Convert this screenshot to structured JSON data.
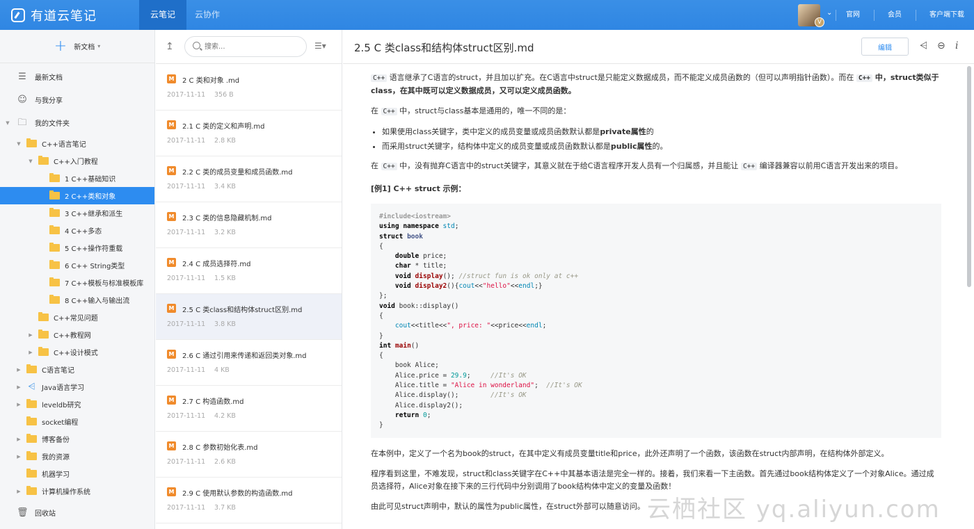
{
  "app": {
    "name": "有道云笔记"
  },
  "topnav": {
    "tabs": [
      "云笔记",
      "云协作"
    ],
    "links": [
      "官网",
      "会员",
      "客户端下载"
    ],
    "avatar_badge": "V"
  },
  "sidebar": {
    "new_doc": "新文档",
    "items": [
      {
        "label": "最新文档",
        "icon": "clock-stack-icon"
      },
      {
        "label": "与我分享",
        "icon": "user-share-icon"
      },
      {
        "label": "我的文件夹",
        "icon": "folder-outline-icon"
      },
      {
        "label": "C++语言笔记"
      },
      {
        "label": "C++入门教程"
      },
      {
        "label": "1 C++基础知识"
      },
      {
        "label": "2 C++类和对象"
      },
      {
        "label": "3 C++继承和派生"
      },
      {
        "label": "4 C++多态"
      },
      {
        "label": "5 C++操作符重载"
      },
      {
        "label": "6 C++ String类型"
      },
      {
        "label": "7 C++模板与标准模板库"
      },
      {
        "label": "8 C++输入与输出流"
      },
      {
        "label": "C++常见问题"
      },
      {
        "label": "C++教程网"
      },
      {
        "label": "C++设计模式"
      },
      {
        "label": "C语言笔记"
      },
      {
        "label": "Java语言学习"
      },
      {
        "label": "leveldb研究"
      },
      {
        "label": "socket编程"
      },
      {
        "label": "博客备份"
      },
      {
        "label": "我的资源"
      },
      {
        "label": "机器学习"
      },
      {
        "label": "计算机操作系统"
      }
    ],
    "trash": "回收站"
  },
  "list": {
    "search_placeholder": "搜索...",
    "items": [
      {
        "title": "2 C 类和对象 .md",
        "date": "2017-11-11",
        "size": "356 B"
      },
      {
        "title": "2.1 C 类的定义和声明.md",
        "date": "2017-11-11",
        "size": "2.8 KB"
      },
      {
        "title": "2.2 C 类的成员变量和成员函数.md",
        "date": "2017-11-11",
        "size": "3.4 KB"
      },
      {
        "title": "2.3 C 类的信息隐藏机制.md",
        "date": "2017-11-11",
        "size": "3.2 KB"
      },
      {
        "title": "2.4 C 成员选择符.md",
        "date": "2017-11-11",
        "size": "1.5 KB"
      },
      {
        "title": "2.5 C 类class和结构体struct区别.md",
        "date": "2017-11-11",
        "size": "3.8 KB"
      },
      {
        "title": "2.6 C 通过引用来传递和返回类对象.md",
        "date": "2017-11-11",
        "size": "4 KB"
      },
      {
        "title": "2.7 C 构造函数.md",
        "date": "2017-11-11",
        "size": "4.2 KB"
      },
      {
        "title": "2.8 C 参数初始化表.md",
        "date": "2017-11-11",
        "size": "2.6 KB"
      },
      {
        "title": "2.9 C 使用默认参数的构造函数.md",
        "date": "2017-11-11",
        "size": "3.7 KB"
      }
    ]
  },
  "doc": {
    "title": "2.5 C  类class和结构体struct区别.md",
    "edit_label": "编辑",
    "p1_kw": "C++",
    "p1_a": " 语言继承了C语言的struct，并且加以扩充。在C语言中struct是只能定义数据成员，而不能定义成员函数的（但可以声明指针函数）。而在 ",
    "p1_kw2": "C++",
    "p1_b": " 中，struct类似于class，在其中既可以定义数据成员，又可以定义成员函数。",
    "p2_a": "在 ",
    "p2_kw": "C++",
    "p2_b": " 中，struct与class基本是通用的，唯一不同的是：",
    "li1_a": "如果使用class关键字，类中定义的成员变量或成员函数默认都是",
    "li1_b": "private属性",
    "li1_c": "的",
    "li2_a": "而采用struct关键字，结构体中定义的成员变量或成员函数默认都是",
    "li2_b": "public属性",
    "li2_c": "的。",
    "p3_a": "在 ",
    "p3_kw": "C++",
    "p3_b": " 中，没有抛弃C语言中的struct关键字，其意义就在于给C语言程序开发人员有一个归属感，并且能让 ",
    "p3_kw2": "C++",
    "p3_c": " 编译器兼容以前用C语言开发出来的项目。",
    "example_heading": "[例1] C++ struct 示例：",
    "p4": "在本例中，定义了一个名为book的struct，在其中定义有成员变量title和price，此外还声明了一个函数，该函数在struct内部声明，在结构体外部定义。",
    "p5": "程序看到这里，不难发现，struct和class关键字在C++中其基本语法是完全一样的。接着，我们来看一下主函数。首先通过book结构体定义了一个对象Alice。通过成员选择符，Alice对象在接下来的三行代码中分别调用了book结构体中定义的变量及函数！",
    "p6": "由此可见struct声明中，默认的属性为public属性，在struct外部可以随意访问。"
  },
  "watermark": "云栖社区 yq.aliyun.com"
}
